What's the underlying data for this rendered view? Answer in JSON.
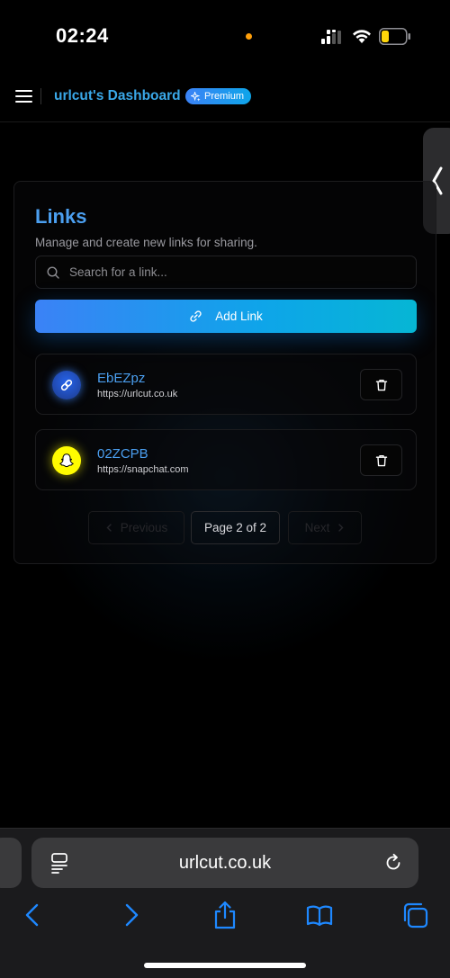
{
  "status_bar": {
    "time": "02:24"
  },
  "header": {
    "title": "urlcut's Dashboard",
    "badge": "Premium"
  },
  "card": {
    "title": "Links",
    "subtitle": "Manage and create new links for sharing.",
    "search_placeholder": "Search for a link...",
    "add_button_label": "Add Link",
    "links": [
      {
        "code": "EbEZpz",
        "url": "https://urlcut.co.uk",
        "icon": "link-icon",
        "color": "#2563eb"
      },
      {
        "code": "02ZCPB",
        "url": "https://snapchat.com",
        "icon": "snapchat-icon",
        "color": "#fffc00"
      }
    ],
    "pagination": {
      "previous_label": "Previous",
      "info": "Page 2 of 2",
      "next_label": "Next"
    }
  },
  "browser": {
    "address": "urlcut.co.uk"
  },
  "colors": {
    "accent": "#4b9ff0",
    "button_gradient_start": "#3b82f6",
    "button_gradient_end": "#06b6d4",
    "status_dot": "#ff9f0a"
  }
}
